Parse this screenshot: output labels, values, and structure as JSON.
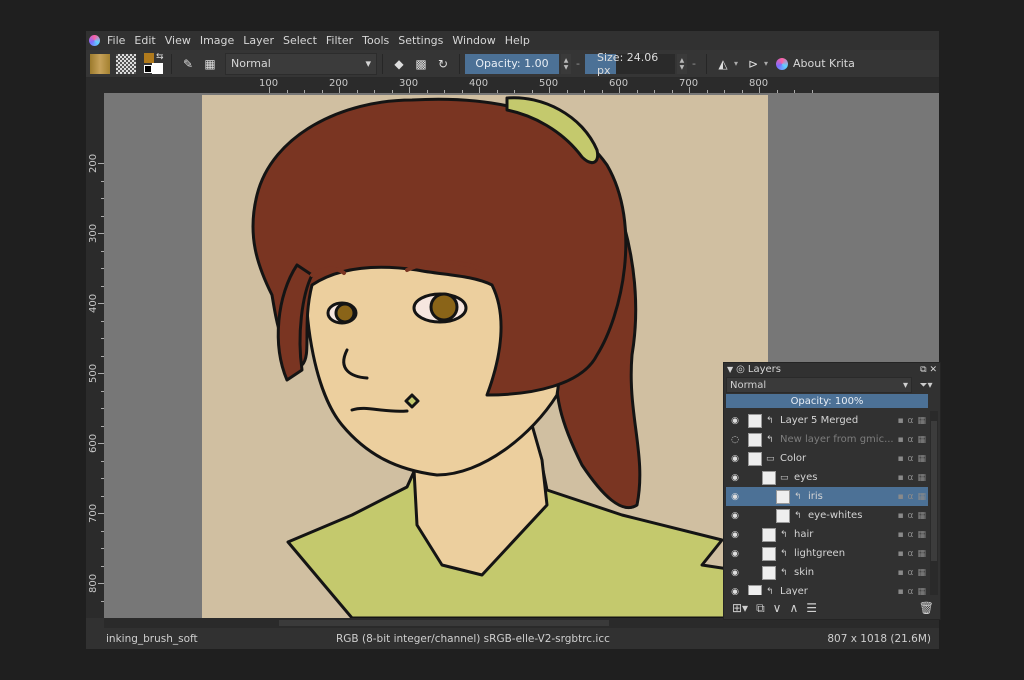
{
  "menu": [
    "File",
    "Edit",
    "View",
    "Image",
    "Layer",
    "Select",
    "Filter",
    "Tools",
    "Settings",
    "Window",
    "Help"
  ],
  "toolbar": {
    "blend_mode": "Normal",
    "opacity_label": "Opacity:  1.00",
    "size_label": "Size:  24.06 px",
    "size_fraction": 0.35,
    "about_label": "About Krita",
    "foreground_color": "#b07a1c",
    "background_color": "#ffffff"
  },
  "rulers": {
    "top": [
      "100",
      "200",
      "300",
      "400",
      "500",
      "600",
      "700",
      "800"
    ],
    "left": [
      "200",
      "300",
      "400",
      "500",
      "600",
      "700",
      "800"
    ]
  },
  "canvas": {
    "background": "#d0bfa1",
    "hair_color": "#7a3522",
    "skin_color": "#eccf9e",
    "shirt_color": "#c4c96d",
    "eye_color": "#8a6418"
  },
  "layers_docker": {
    "title": "Layers",
    "blend_mode": "Normal",
    "opacity_label": "Opacity:  100%",
    "layers": [
      {
        "name": "Layer 5 Merged",
        "visible": true,
        "indent": 0,
        "type": "paint",
        "selected": false,
        "dimmed": false
      },
      {
        "name": "New layer from gmic...",
        "visible": false,
        "indent": 0,
        "type": "paint",
        "selected": false,
        "dimmed": true
      },
      {
        "name": "Color",
        "visible": true,
        "indent": 0,
        "type": "group",
        "selected": false,
        "dimmed": false
      },
      {
        "name": "eyes",
        "visible": true,
        "indent": 1,
        "type": "group",
        "selected": false,
        "dimmed": false
      },
      {
        "name": "iris",
        "visible": true,
        "indent": 2,
        "type": "paint",
        "selected": true,
        "dimmed": false
      },
      {
        "name": "eye-whites",
        "visible": true,
        "indent": 2,
        "type": "paint",
        "selected": false,
        "dimmed": false
      },
      {
        "name": "hair",
        "visible": true,
        "indent": 1,
        "type": "paint",
        "selected": false,
        "dimmed": false
      },
      {
        "name": "lightgreen",
        "visible": true,
        "indent": 1,
        "type": "paint",
        "selected": false,
        "dimmed": false
      },
      {
        "name": "skin",
        "visible": true,
        "indent": 1,
        "type": "paint",
        "selected": false,
        "dimmed": false
      },
      {
        "name": "Layer",
        "visible": true,
        "indent": 0,
        "type": "paint",
        "selected": false,
        "dimmed": false
      }
    ]
  },
  "status": {
    "brush": "inking_brush_soft",
    "color_profile": "RGB (8-bit integer/channel)  sRGB-elle-V2-srgbtrc.icc",
    "image_size": "807 x 1018 (21.6M)"
  }
}
